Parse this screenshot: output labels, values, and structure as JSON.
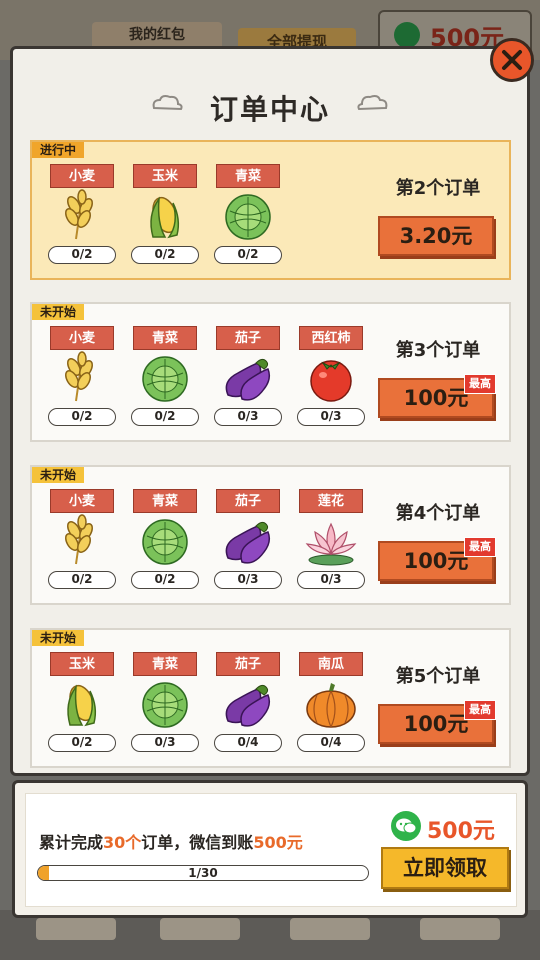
{
  "background": {
    "red_packet_label": "我的红包",
    "withdraw_label": "全部提现",
    "wallet_amount": "500元"
  },
  "panel": {
    "title": "订单中心",
    "close_icon": "close-icon"
  },
  "orders": [
    {
      "status": "进行中",
      "order_no": "第2个订单",
      "price": "3.20元",
      "best": "",
      "items": [
        {
          "label": "小麦",
          "count": "0/2",
          "icon": "wheat-icon"
        },
        {
          "label": "玉米",
          "count": "0/2",
          "icon": "corn-icon"
        },
        {
          "label": "青菜",
          "count": "0/2",
          "icon": "cabbage-icon"
        }
      ]
    },
    {
      "status": "未开始",
      "order_no": "第3个订单",
      "price": "100元",
      "best": "最高",
      "items": [
        {
          "label": "小麦",
          "count": "0/2",
          "icon": "wheat-icon"
        },
        {
          "label": "青菜",
          "count": "0/2",
          "icon": "cabbage-icon"
        },
        {
          "label": "茄子",
          "count": "0/3",
          "icon": "eggplant-icon"
        },
        {
          "label": "西红柿",
          "count": "0/3",
          "icon": "tomato-icon"
        }
      ]
    },
    {
      "status": "未开始",
      "order_no": "第4个订单",
      "price": "100元",
      "best": "最高",
      "items": [
        {
          "label": "小麦",
          "count": "0/2",
          "icon": "wheat-icon"
        },
        {
          "label": "青菜",
          "count": "0/2",
          "icon": "cabbage-icon"
        },
        {
          "label": "茄子",
          "count": "0/3",
          "icon": "eggplant-icon"
        },
        {
          "label": "莲花",
          "count": "0/3",
          "icon": "lotus-icon"
        }
      ]
    },
    {
      "status": "未开始",
      "order_no": "第5个订单",
      "price": "100元",
      "best": "最高",
      "items": [
        {
          "label": "玉米",
          "count": "0/2",
          "icon": "corn-icon"
        },
        {
          "label": "青菜",
          "count": "0/3",
          "icon": "cabbage-icon"
        },
        {
          "label": "茄子",
          "count": "0/4",
          "icon": "eggplant-icon"
        },
        {
          "label": "南瓜",
          "count": "0/4",
          "icon": "pumpkin-icon"
        }
      ]
    }
  ],
  "summary": {
    "text_prefix": "累计完成",
    "text_highlight1": "30个",
    "text_mid": "订单，微信到账",
    "text_highlight2": "500元",
    "reward_amount": "500元",
    "progress_label": "1/30",
    "progress_fraction": 0.0333,
    "claim_label": "立即领取"
  },
  "colors": {
    "accent_orange": "#e9713a",
    "label_red": "#d75f4b",
    "gold": "#f5b82a"
  }
}
